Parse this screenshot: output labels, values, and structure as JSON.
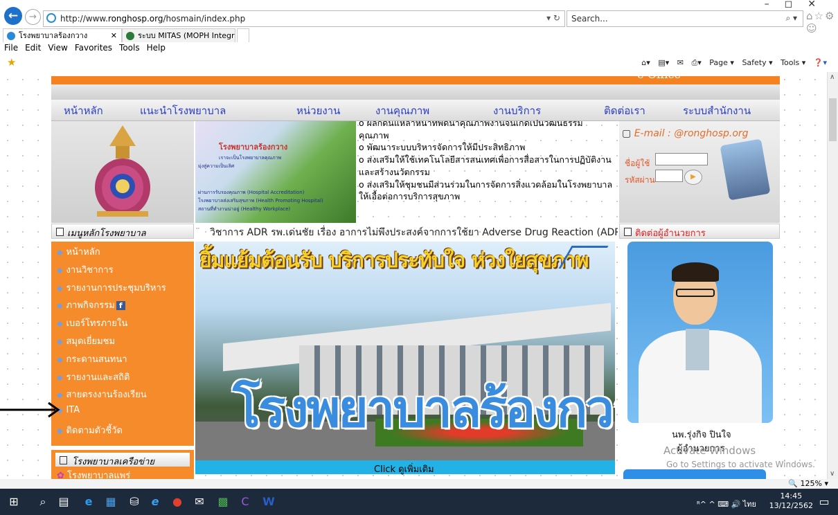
{
  "browser": {
    "url_prefix": "http://www.",
    "url_domain": "ronghosp.org",
    "url_path": "/hosmain/index.php",
    "addr_controls": "▾ ↻",
    "search_placeholder": "Search...",
    "tabs": [
      {
        "label": "โรงพยาบาลร้องกวาง"
      },
      {
        "label": "ระบบ MITAS (MOPH Integrity a..."
      }
    ],
    "menu": [
      "File",
      "Edit",
      "View",
      "Favorites",
      "Tools",
      "Help"
    ],
    "commands": [
      "Page ▾",
      "Safety ▾",
      "Tools ▾"
    ],
    "zoom": "🔍 125%  ▾"
  },
  "site": {
    "eoffice": "e-Office",
    "nav": [
      "หน้าหลัก",
      "แนะนำโรงพยาบาล",
      "หน่วยงาน",
      "งานคุณภาพ",
      "งานบริการ",
      "ติดต่อเรา",
      "ระบบสำนักงาน"
    ],
    "banner_heading": "โรงพยาบาลร้องกวาง",
    "banner_lines": [
      "เราจะเป็นโรงพยาบาลคุณภาพ",
      "มุ่งสู่ความเป็นเลิศ",
      "ผ่านการรับรองคุณภาพ (Hospital Accreditation)",
      "โรงพยาบาลส่งเสริมสุขภาพ (Health Promoting Hospital)",
      "สถานที่ทำงานน่าอยู่ (Healthy Workplace)"
    ],
    "vision_lines": [
      "o ผลกดนแหลาหนาทพดนาคุณภาพงานจนเกดเปนวฒนธรรม",
      "คุณภาพ",
      "o พัฒนาระบบบริหารจัดการให้มีประสิทธิภาพ",
      "o ส่งเสริมให้ใช้เทคโนโลยีสารสนเทศเพื่อการสื่อสารในการปฏิบัติงาน",
      "และสร้างนวัตกรรม",
      "o ส่งเสริมให้ชุมชนมีส่วนร่วมในการจัดการสิ่งแวดล้อมในโรงพยาบาล",
      "ให้เอื้อต่อการบริการสุขภาพ"
    ],
    "email_header": "E-mail : @ronghosp.org",
    "username_label": "ชื่อผู้ใช้",
    "password_label": "รหัสผ่าน",
    "left_header": "เมนูหลักโรงพยาบาล",
    "left_menu": [
      "หน้าหลัก",
      "งานวิชาการ",
      "รายงานการประชุมบริหาร",
      "ภาพกิจกรรม",
      "เบอร์โทรภายใน",
      "สมุดเยี่ยมชม",
      "กระดานสนทนา",
      "รายงานและสถิติ",
      "สายตรงงานร้องเรียน",
      "ITA",
      "ติดตามตัวชี้วัด"
    ],
    "facebook_badge": "f",
    "marquee": "วิชาการ ADR รพ.เด่นชัย เรื่อง อาการไม่พึงประสงค์จากการใช้ยา Adverse Drug Reaction (ADR",
    "hero_slogan": "ยิ้มแย้มต้อนรับ บริการประทับใจ ห่วงใยสุขภาพ",
    "hero_big": "โรงพยาบาลร้องกวาง",
    "click_more": "Click ดูเพิ่มเติม",
    "director_header": "ติดต่อผู้อำนวยการ",
    "director_name": "นพ.รุ่งกิจ ปินใจ",
    "director_title": "ผู้อำนวยการ",
    "left_header2": "โรงพยาบาลเครือข่าย",
    "left_sub2": "โรงพยาบาลแพร่",
    "watermark1": "Activate Windows",
    "watermark2": "Go to Settings to activate Windows."
  },
  "taskbar": {
    "tray": "ᴿ^  ^ ⌨ 🔊  ไทย",
    "time": "14:45",
    "date": "13/12/2562"
  },
  "colors": {
    "orange": "#f58220",
    "nav_text": "#2a3cc8",
    "clickbar": "#22b2e6"
  }
}
